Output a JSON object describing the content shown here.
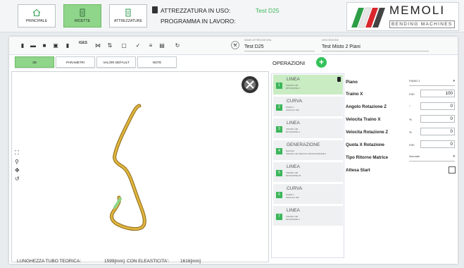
{
  "nav": {
    "principale": "PRINCIPALE",
    "ricette": "RICETTE",
    "attrezzature": "ATTREZZATURE"
  },
  "status": {
    "attrezzatura_label": "ATTREZZATURA IN USO:",
    "attrezzatura_value": "Test D25",
    "programma_label": "PROGRAMMA IN LAVORO:"
  },
  "brand": {
    "name": "MEMOLI",
    "tagline": "BENDING MACHINES"
  },
  "toolbar": {
    "iges_label": "IGES",
    "tool_field_label": "NOME ATTREZZATURA",
    "tool_field_value": "Test D25",
    "desc_field_label": "DESCRIZIONE",
    "desc_field_value": "Test Misto 2 Piani"
  },
  "tabs": [
    "3D",
    "PARAMETRI",
    "VALORI DEFAULT",
    "NOTE"
  ],
  "operations_title": "OPERAZIONI",
  "add_label": "+",
  "operations": [
    {
      "num": "1",
      "name": "LINEA",
      "sub": "TRAINO 100\nROTAZIONE 0"
    },
    {
      "num": "2",
      "name": "CURVA",
      "sub": "PIANO 1\nANGOLO 180"
    },
    {
      "num": "3",
      "name": "LINEA",
      "sub": "TRAINO 100\nROTAZIONE 0"
    },
    {
      "num": "4",
      "name": "GENERAZIONE",
      "sub": "RAGGIO\nTRAINO 100 ANGOLO 180 ROTAZIONE 0"
    },
    {
      "num": "5",
      "name": "LINEA",
      "sub": "TRAINO 100\nROTAZIONE 90"
    },
    {
      "num": "6",
      "name": "CURVA",
      "sub": "PIANO 1\nANGOLO 180"
    },
    {
      "num": "7",
      "name": "LINEA",
      "sub": "TRAINO 100\nROTAZIONE 0"
    }
  ],
  "params": {
    "piano": {
      "label": "Piano",
      "value": "PIANO 1"
    },
    "traino_x": {
      "label": "Traino X",
      "unit": "mm",
      "value": "100"
    },
    "angolo_rot_z": {
      "label": "Angolo Rotazione Z",
      "unit": "°",
      "value": "0"
    },
    "velocita_traino_x": {
      "label": "Velocita Traino X",
      "unit": "%",
      "value": "0"
    },
    "velocita_rot_z": {
      "label": "Velocita Rotazione Z",
      "unit": "%",
      "value": "0"
    },
    "quota_x_rot": {
      "label": "Quota X Rotazione",
      "unit": "mm",
      "value": "0"
    },
    "tipo_ritorno": {
      "label": "Tipo Ritorno Matrice",
      "value": "Normale"
    },
    "attesa_start": {
      "label": "Attesa Start"
    }
  },
  "footer": {
    "lunghezza_label": "LUNGHEZZA TUBO  TEORICA:",
    "lunghezza_value": "1599[mm]",
    "elasticita_label": "CON ELEASTICITA':",
    "elasticita_value": "1616[mm]"
  },
  "colors": {
    "accent_green": "#8fd58a",
    "op_green": "#3bb65a",
    "tube_yellow": "#d9a93a",
    "tube_tip_green": "#8fd58a"
  }
}
